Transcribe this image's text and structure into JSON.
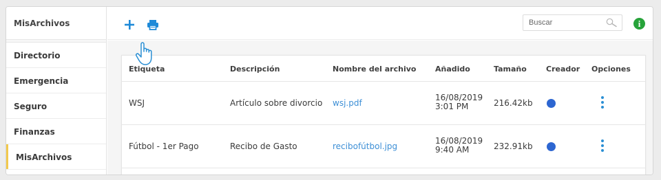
{
  "sidebar": {
    "title": "MisArchivos",
    "items": [
      {
        "label": "Directorio"
      },
      {
        "label": "Emergencia"
      },
      {
        "label": "Seguro"
      },
      {
        "label": "Finanzas"
      },
      {
        "label": "MisArchivos"
      }
    ],
    "active_index": 4,
    "active_color": "#f2c94c"
  },
  "toolbar": {
    "add_icon": "plus-icon",
    "print_icon": "printer-icon",
    "accent_color": "#1f8ad8"
  },
  "search": {
    "placeholder": "Buscar",
    "icon": "search-icon"
  },
  "info": {
    "label": "i",
    "color": "#27a33a"
  },
  "table": {
    "headers": [
      "Etiqueta",
      "Descripción",
      "Nombre del archivo",
      "Añadido",
      "Tamaño",
      "Creador",
      "Opciones"
    ],
    "rows": [
      {
        "tag": "WSJ",
        "description": "Artículo sobre divorcio",
        "file": "wsj.pdf",
        "date": "16/08/2019",
        "time": "3:01 PM",
        "size": "216.42kb"
      },
      {
        "tag": "Fútbol - 1er Pago",
        "description": "Recibo de Gasto",
        "file": "recibofútbol.jpg",
        "date": "16/08/2019",
        "time": "9:40 AM",
        "size": "232.91kb"
      }
    ],
    "creator_color": "#2d66d1",
    "link_color": "#3d8fd6"
  }
}
